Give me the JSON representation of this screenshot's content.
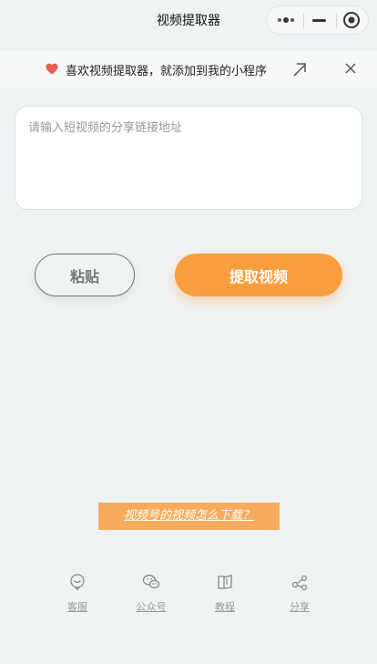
{
  "header": {
    "title": "视频提取器"
  },
  "banner": {
    "text": "喜欢视频提取器，就添加到我的小程序"
  },
  "input": {
    "placeholder": "请输入短视频的分享链接地址",
    "value": ""
  },
  "buttons": {
    "paste_label": "粘贴",
    "extract_label": "提取视频"
  },
  "help_link": {
    "text": "视频号的视频怎么下载？"
  },
  "nav": {
    "items": [
      {
        "label": "客服",
        "icon": "chat-icon"
      },
      {
        "label": "公众号",
        "icon": "wechat-icon"
      },
      {
        "label": "教程",
        "icon": "book-icon"
      },
      {
        "label": "分享",
        "icon": "share-icon"
      }
    ]
  },
  "colors": {
    "accent": "#f99e3e",
    "help_bg": "#f7ac5d",
    "heart": "#e8614f",
    "background": "#f0f3f4"
  }
}
